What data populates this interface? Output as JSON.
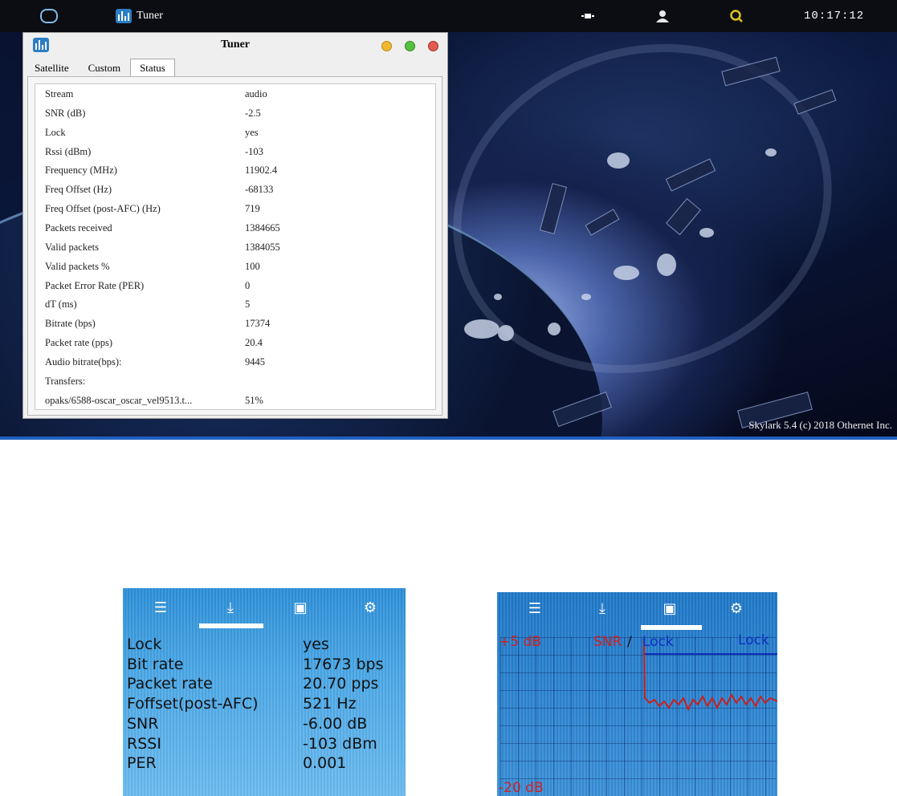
{
  "taskbar": {
    "app_label": "Tuner",
    "launcher_icon": "circle-launcher-icon",
    "status_icons": [
      "network-icon",
      "user-icon",
      "search-icon"
    ],
    "clock": "10:17:12"
  },
  "desktop": {
    "copyright": "Skylark 5.4 (c) 2018 Othernet Inc."
  },
  "window": {
    "title": "Tuner",
    "tabs": [
      {
        "label": "Satellite",
        "active": false
      },
      {
        "label": "Custom",
        "active": false
      },
      {
        "label": "Status",
        "active": true
      }
    ],
    "status_rows": [
      {
        "key": "Stream",
        "value": "audio"
      },
      {
        "key": "SNR (dB)",
        "value": "-2.5"
      },
      {
        "key": "Lock",
        "value": "yes"
      },
      {
        "key": "Rssi (dBm)",
        "value": "-103"
      },
      {
        "key": "Frequency (MHz)",
        "value": "11902.4"
      },
      {
        "key": "Freq Offset (Hz)",
        "value": "-68133"
      },
      {
        "key": "Freq Offset (post-AFC) (Hz)",
        "value": "719"
      },
      {
        "key": "Packets received",
        "value": "1384665"
      },
      {
        "key": "Valid packets",
        "value": "1384055"
      },
      {
        "key": "Valid packets %",
        "value": "100"
      },
      {
        "key": "Packet Error Rate (PER)",
        "value": "0"
      },
      {
        "key": "dT (ms)",
        "value": "5"
      },
      {
        "key": "Bitrate (bps)",
        "value": "17374"
      },
      {
        "key": "Packet rate (pps)",
        "value": "20.4"
      },
      {
        "key": "Audio bitrate(bps):",
        "value": "9445"
      },
      {
        "key": "Transfers:",
        "value": ""
      },
      {
        "key": "opaks/6588-oscar_oscar_vel9513.t...",
        "value": "51%"
      }
    ]
  },
  "device_status": {
    "nav_icons": [
      "list-icon",
      "download-icon",
      "image-icon",
      "gear-icon"
    ],
    "rows": [
      {
        "key": "Lock",
        "value": "yes"
      },
      {
        "key": "Bit rate",
        "value": "17673 bps"
      },
      {
        "key": "Packet rate",
        "value": "20.70 pps"
      },
      {
        "key": "Foffset(post-AFC)",
        "value": "521 Hz"
      },
      {
        "key": "SNR",
        "value": "-6.00 dB"
      },
      {
        "key": "RSSI",
        "value": "-103 dBm"
      },
      {
        "key": "PER",
        "value": "0.001"
      }
    ]
  },
  "device_graph": {
    "nav_icons": [
      "list-icon",
      "download-icon",
      "image-icon",
      "gear-icon"
    ],
    "top_label": "+5 dB",
    "bottom_label": "-20 dB",
    "snr_label": "SNR",
    "separator": "/",
    "lock_label": "Lock",
    "lock_right_label": "Lock",
    "snr_color": "#d02020",
    "lock_color": "#1030c0"
  }
}
